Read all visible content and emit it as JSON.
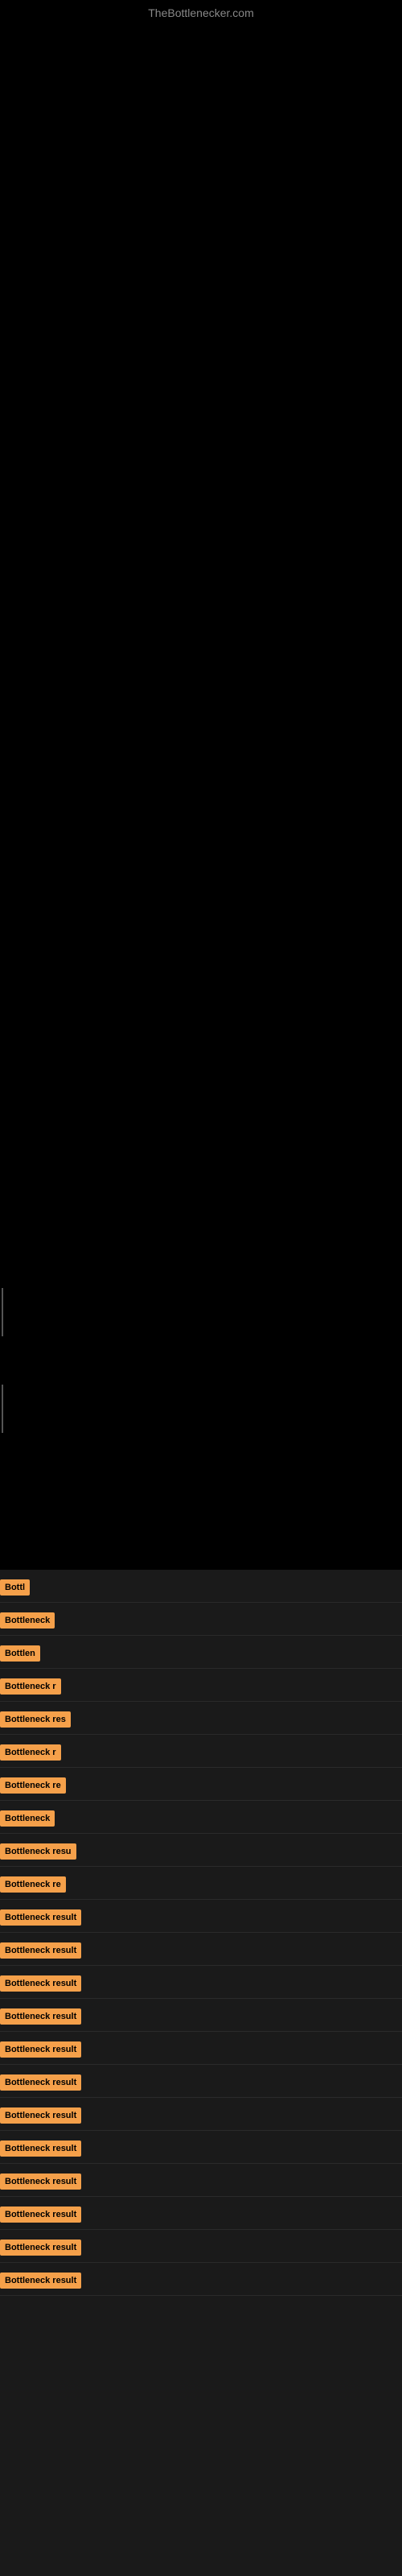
{
  "site": {
    "title": "TheBottlenecker.com"
  },
  "results": [
    {
      "label": "Bottl",
      "width": 42
    },
    {
      "label": "Bottleneck",
      "width": 72
    },
    {
      "label": "Bottlen",
      "width": 52
    },
    {
      "label": "Bottleneck r",
      "width": 85
    },
    {
      "label": "Bottleneck res",
      "width": 100
    },
    {
      "label": "Bottleneck r",
      "width": 85
    },
    {
      "label": "Bottleneck re",
      "width": 92
    },
    {
      "label": "Bottleneck",
      "width": 75
    },
    {
      "label": "Bottleneck resu",
      "width": 108
    },
    {
      "label": "Bottleneck re",
      "width": 96
    },
    {
      "label": "Bottleneck result",
      "width": 120
    },
    {
      "label": "Bottleneck result",
      "width": 120
    },
    {
      "label": "Bottleneck result",
      "width": 120
    },
    {
      "label": "Bottleneck result",
      "width": 120
    },
    {
      "label": "Bottleneck result",
      "width": 120
    },
    {
      "label": "Bottleneck result",
      "width": 120
    },
    {
      "label": "Bottleneck result",
      "width": 120
    },
    {
      "label": "Bottleneck result",
      "width": 120
    },
    {
      "label": "Bottleneck result",
      "width": 120
    },
    {
      "label": "Bottleneck result",
      "width": 120
    },
    {
      "label": "Bottleneck result",
      "width": 120
    },
    {
      "label": "Bottleneck result",
      "width": 120
    }
  ]
}
